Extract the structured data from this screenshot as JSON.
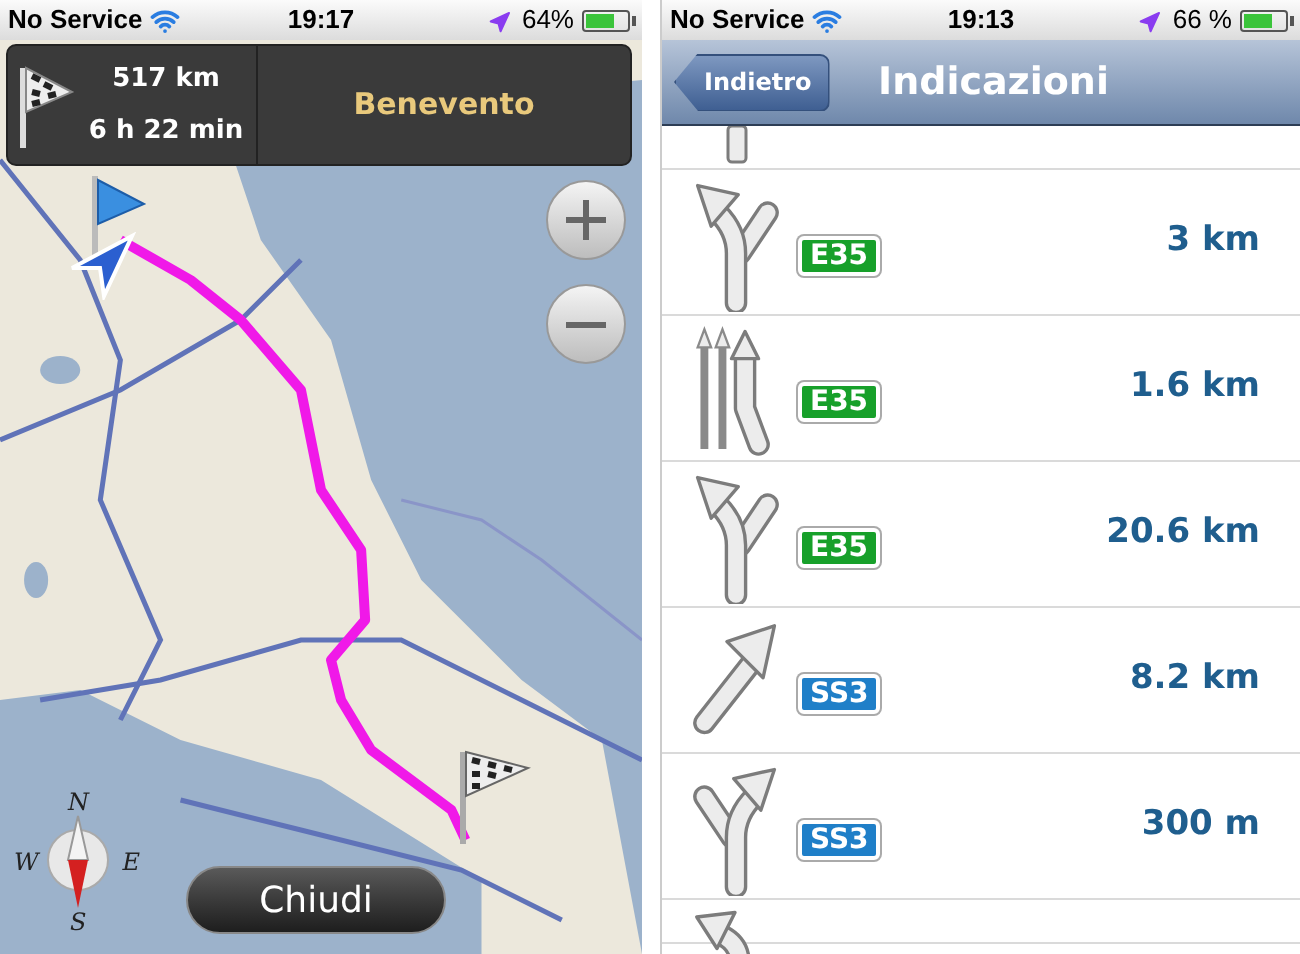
{
  "left_screen": {
    "status_bar": {
      "carrier": "No Service",
      "time": "19:17",
      "battery": "64%"
    },
    "route_summary": {
      "distance": "517 km",
      "duration": "6 h 22 min",
      "destination": "Benevento"
    },
    "compass": {
      "north": "N",
      "west": "W",
      "east": "E",
      "south": "S"
    },
    "close_button": "Chiudi"
  },
  "right_screen": {
    "status_bar": {
      "carrier": "No Service",
      "time": "19:13",
      "battery": "66 %"
    },
    "back_button": "Indietro",
    "title": "Indicazioni",
    "directions": [
      {
        "kind": "straight"
      },
      {
        "kind": "keep_left",
        "road": "E35",
        "color": "#17a02a",
        "distance": "3 km"
      },
      {
        "kind": "lanes",
        "road": "E35",
        "color": "#17a02a",
        "distance": "1.6 km"
      },
      {
        "kind": "keep_left",
        "road": "E35",
        "color": "#17a02a",
        "distance": "20.6 km"
      },
      {
        "kind": "bear_right",
        "road": "SS3",
        "color": "#1f7fc8",
        "distance": "8.2 km"
      },
      {
        "kind": "keep_right",
        "road": "SS3",
        "color": "#1f7fc8",
        "distance": "300 m"
      },
      {
        "kind": "sharp_left"
      }
    ]
  }
}
